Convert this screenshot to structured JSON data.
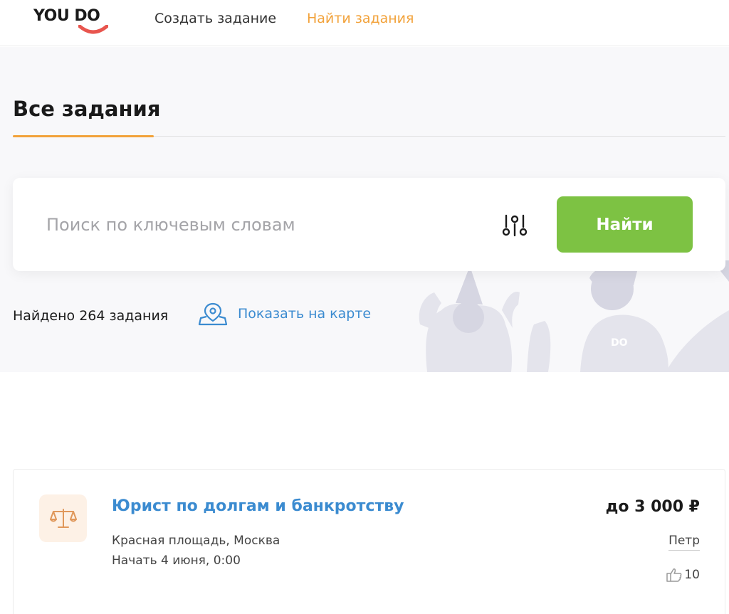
{
  "header": {
    "logo_text": "YOU DO",
    "nav": {
      "create": "Создать задание",
      "find": "Найти задания"
    }
  },
  "hero": {
    "title": "Все задания",
    "search": {
      "placeholder": "Поиск по ключевым словам",
      "value": "",
      "button": "Найти"
    },
    "found": "Найдено 264 задания",
    "map_link": "Показать на карте"
  },
  "task": {
    "title": "Юрист по долгам и банкротству",
    "address": "Красная площадь, Москва",
    "start": "Начать 4 июня, 0:00",
    "price": "до 3 000 ₽",
    "author": "Петр",
    "rating": "10",
    "category_icon": "scales-icon"
  },
  "colors": {
    "accent_orange": "#f2a23a",
    "accent_green": "#7dc243",
    "link_blue": "#3b8bd0",
    "logo_red": "#e8554e"
  }
}
